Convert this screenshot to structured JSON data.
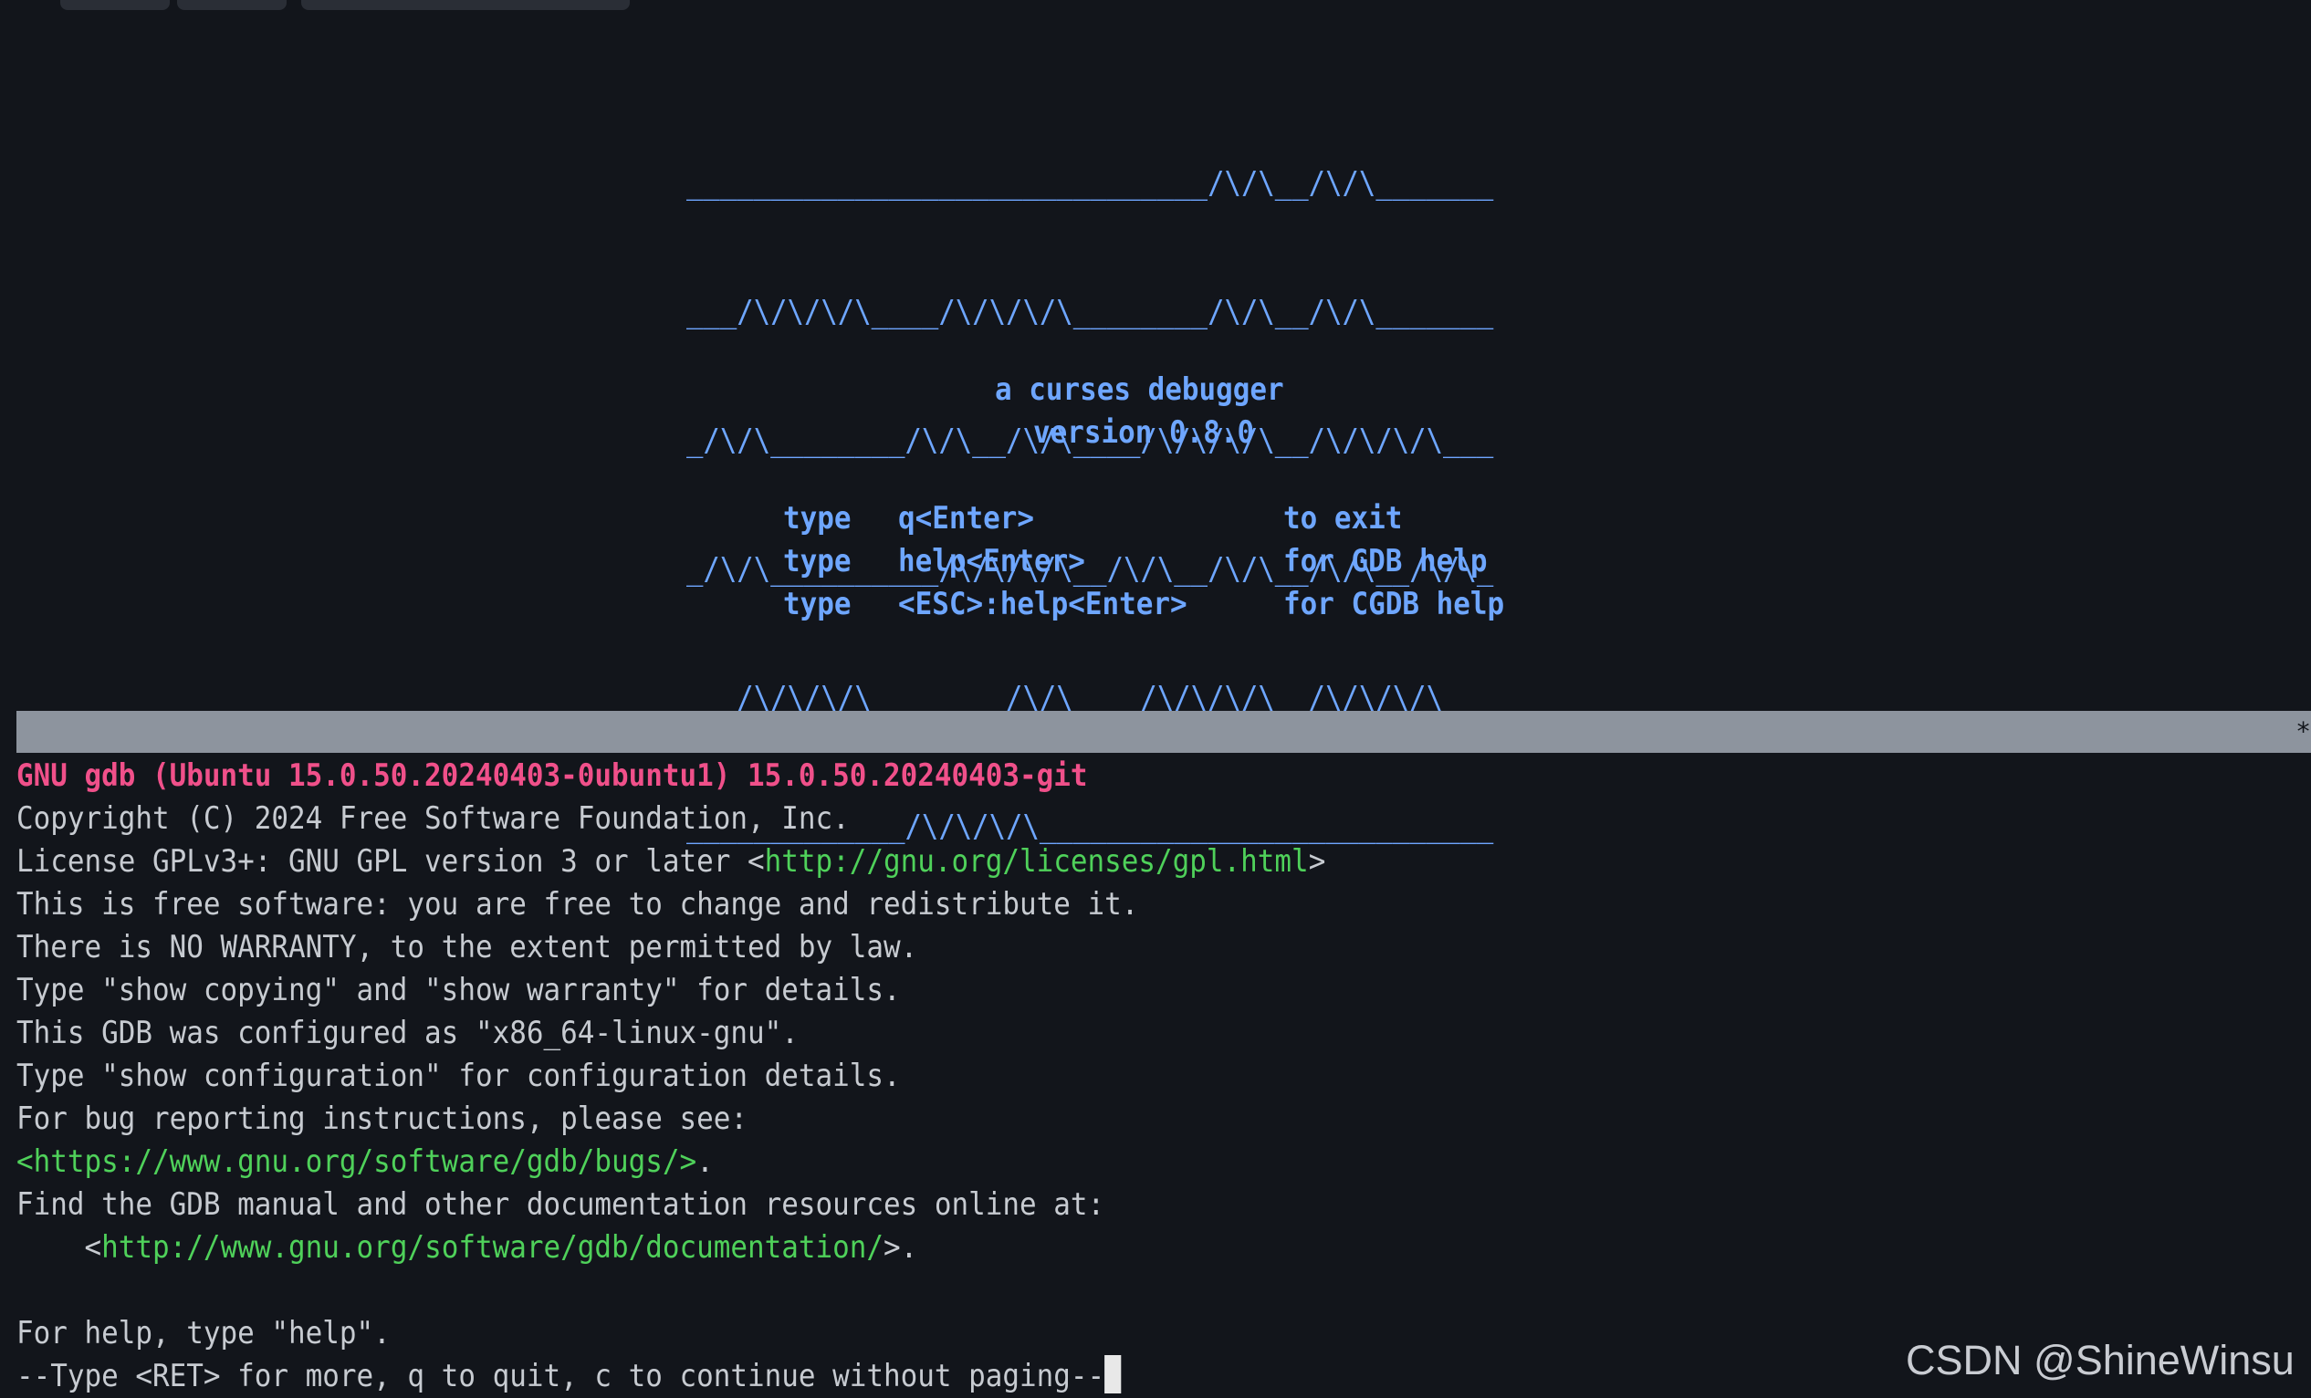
{
  "logo_lines": [
    "_______________________________/\\/\\__/\\/\\_______",
    "___/\\/\\/\\/\\____/\\/\\/\\/\\________/\\/\\__/\\/\\_______",
    "_/\\/\\________/\\/\\__/\\/\\____/\\/\\/\\/\\__/\\/\\/\\/\\___",
    "_/\\/\\__________/\\/\\/\\/\\__/\\/\\__/\\/\\__/\\/\\__/\\/\\_",
    "___/\\/\\/\\/\\________/\\/\\____/\\/\\/\\/\\__/\\/\\/\\/\\___",
    "_____________/\\/\\/\\/\\___________________________"
  ],
  "tagline": "a curses debugger",
  "version": "version 0.8.0",
  "help_rows": [
    {
      "type": "type",
      "key": "q<Enter>",
      "desc": "to exit"
    },
    {
      "type": "type",
      "key": "help<Enter>",
      "desc": "for GDB help"
    },
    {
      "type": "type",
      "key": "<ESC>:help<Enter>",
      "desc": "for CGDB help"
    }
  ],
  "status_bar": {
    "mark": "*"
  },
  "gdb": {
    "banner": "GNU gdb (Ubuntu 15.0.50.20240403-0ubuntu1) 15.0.50.20240403-git",
    "copyright": "Copyright (C) 2024 Free Software Foundation, Inc.",
    "license_prefix": "License GPLv3+: GNU GPL version 3 or later <",
    "license_url": "http://gnu.org/licenses/gpl.html",
    "license_suffix": ">",
    "free_software": "This is free software: you are free to change and redistribute it.",
    "no_warranty": "There is NO WARRANTY, to the extent permitted by law.",
    "show_copying": "Type \"show copying\" and \"show warranty\" for details.",
    "configured": "This GDB was configured as \"x86_64-linux-gnu\".",
    "show_config": "Type \"show configuration\" for configuration details.",
    "bug_reporting": "For bug reporting instructions, please see:",
    "bugs_url": "<https://www.gnu.org/software/gdb/bugs/>",
    "bugs_suffix": ".",
    "find_manual": "Find the GDB manual and other documentation resources online at:",
    "doc_prefix": "    <",
    "doc_url": "http://www.gnu.org/software/gdb/documentation/",
    "doc_suffix": ">.",
    "help_line": "For help, type \"help\".",
    "pager_prompt": "--Type <RET> for more, q to quit, c to continue without paging--"
  },
  "watermark": "CSDN @ShineWinsu",
  "colors": {
    "background": "#12151b",
    "logo_blue": "#6ea6ff",
    "banner_pink": "#f0508a",
    "url_green": "#4fd15a",
    "status_bar_gray": "#8d949e"
  }
}
